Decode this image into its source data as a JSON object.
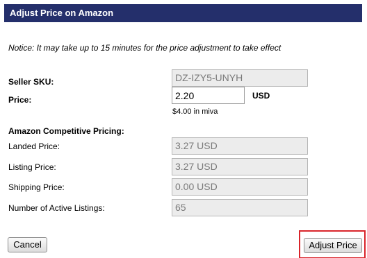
{
  "dialog": {
    "title": "Adjust Price on Amazon",
    "notice": "Notice: It may take up to 15 minutes for the price adjustment to take effect"
  },
  "seller_sku": {
    "label": "Seller SKU:",
    "value": "DZ-IZY5-UNYH"
  },
  "price": {
    "label": "Price:",
    "value": "2.20",
    "currency": "USD",
    "miva_note": "$4.00 in miva"
  },
  "competitive": {
    "heading": "Amazon Competitive Pricing:",
    "landed_label": "Landed Price:",
    "landed_value": "3.27 USD",
    "listing_label": "Listing Price:",
    "listing_value": "3.27 USD",
    "shipping_label": "Shipping Price:",
    "shipping_value": "0.00 USD",
    "active_label": "Number of Active Listings:",
    "active_value": "65"
  },
  "buttons": {
    "cancel": "Cancel",
    "adjust": "Adjust Price"
  },
  "colors": {
    "titlebar": "#242f6b",
    "highlight": "#d9242a"
  }
}
